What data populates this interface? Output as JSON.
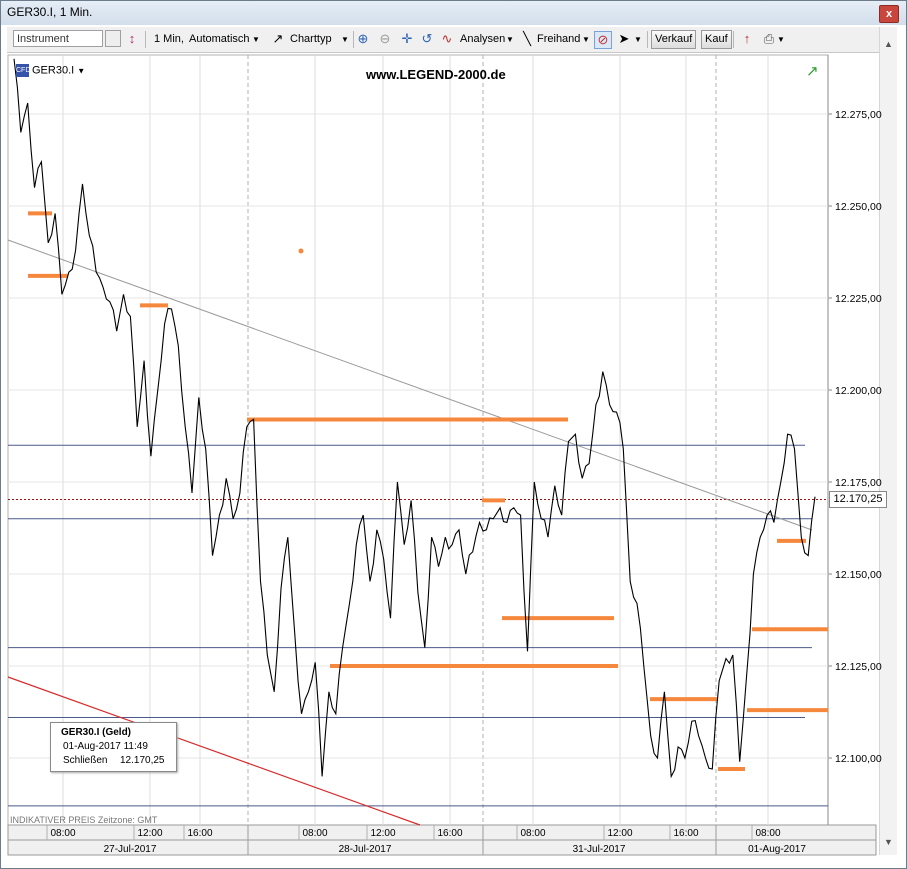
{
  "window": {
    "title": "GER30.I, 1 Min.",
    "close": "x"
  },
  "toolbar": {
    "instrument_placeholder": "Instrument",
    "interval": "1 Min,",
    "scale": "Automatisch",
    "chart_type": "Charttyp",
    "analyses": "Analysen",
    "freehand": "Freihand",
    "sell": "Verkauf",
    "buy": "Kauf"
  },
  "chart_header": {
    "symbol": "GER30.I",
    "logo_text": "www.LEGEND-2000.de"
  },
  "price_badge": "12.170,25",
  "legend": {
    "title": "GER30.I (Geld)",
    "date": "01-Aug-2017 11:49",
    "close_label": "Schließen",
    "close_value": "12.170,25"
  },
  "footer_note": "INDIKATIVER PREIS  Zeitzone: GMT",
  "colors": {
    "price": "#000000",
    "levels": "#f5883c",
    "horizontal": "#4a5a8a",
    "trend_gray": "#9a9a9a",
    "trend_red": "#d62c2c",
    "current": "#a01010"
  },
  "icons": [
    "instrument-list-icon",
    "chart-compare-icon",
    "line-icon",
    "zoom-in-icon",
    "zoom-out-icon",
    "move-icon",
    "refresh-icon",
    "analyses-icon",
    "freehand-icon",
    "eraser-icon",
    "cursor-icon",
    "chart-settings-icon",
    "print-icon",
    "sync-icon"
  ],
  "chart_data": {
    "type": "line",
    "y_axis": {
      "ticks": [
        "12.275,00",
        "12.250,00",
        "12.225,00",
        "12.200,00",
        "12.175,00",
        "12.150,00",
        "12.125,00",
        "12.100,00"
      ],
      "range": [
        12085,
        12295
      ]
    },
    "x_axis": {
      "time_labels": [
        "08:00",
        "12:00",
        "16:00",
        "08:00",
        "12:00",
        "16:00",
        "08:00",
        "12:00",
        "16:00",
        "08:00"
      ],
      "date_labels": [
        "27-Jul-2017",
        "28-Jul-2017",
        "31-Jul-2017",
        "01-Aug-2017"
      ]
    },
    "current_price": 12170.25,
    "horizontal_lines": [
      12185,
      12165,
      12130,
      12111,
      12087
    ],
    "level_segments": [
      {
        "y": 12248
      },
      {
        "y": 12231
      },
      {
        "y": 12223
      },
      {
        "y": 12192
      },
      {
        "y": 12125
      },
      {
        "y": 12170
      },
      {
        "y": 12138
      },
      {
        "y": 12116
      },
      {
        "y": 12097
      },
      {
        "y": 12159
      },
      {
        "y": 12135
      },
      {
        "y": 12113
      }
    ],
    "series": [
      {
        "name": "GER30.I (Geld)",
        "values": [
          12290,
          12270,
          12278,
          12255,
          12262,
          12240,
          12248,
          12226,
          12232,
          12238,
          12256,
          12242,
          12232,
          12228,
          12224,
          12216,
          12226,
          12220,
          12190,
          12208,
          12182,
          12200,
          12218,
          12222,
          12212,
          12190,
          12172,
          12198,
          12184,
          12155,
          12166,
          12176,
          12165,
          12172,
          12190,
          12192,
          12148,
          12128,
          12118,
          12146,
          12160,
          12134,
          12112,
          12118,
          12126,
          12095,
          12118,
          12112,
          12130,
          12142,
          12158,
          12166,
          12148,
          12162,
          12154,
          12138,
          12175,
          12158,
          12170,
          12145,
          12130,
          12160,
          12152,
          12160,
          12158,
          12162,
          12150,
          12156,
          12164,
          12162,
          12165,
          12168,
          12164,
          12168,
          12166,
          12129,
          12175,
          12165,
          12160,
          12174,
          12166,
          12186,
          12188,
          12176,
          12180,
          12196,
          12205,
          12196,
          12194,
          12184,
          12148,
          12142,
          12125,
          12106,
          12100,
          12118,
          12095,
          12103,
          12100,
          12110,
          12106,
          12100,
          12097,
          12121,
          12127,
          12128,
          12099,
          12122,
          12150,
          12160,
          12166,
          12164,
          12175,
          12188,
          12184,
          12160,
          12155,
          12171
        ]
      }
    ]
  }
}
